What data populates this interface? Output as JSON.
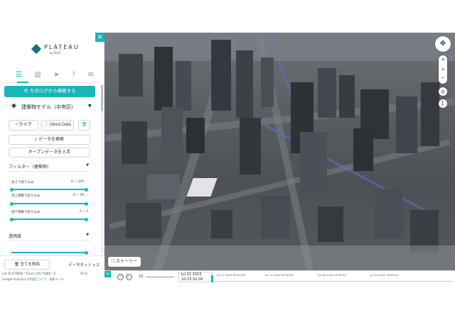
{
  "logo": {
    "name": "PLATEAU",
    "sub": "by MLIT"
  },
  "sidebar": {
    "close_icon": "×",
    "nav_icons": [
      "layers-icon",
      "buildings-icon",
      "share-icon",
      "help-icon",
      "feedback-icon"
    ],
    "catalog_button": "カタログから検索する",
    "layer": {
      "title": "建築物モデル（中央区）"
    },
    "camera_button": "カメラ",
    "about_button": "About Data",
    "search_data_button": "データを検索",
    "opendata_button": "オープンデータを入手",
    "filter": {
      "title": "フィルター（建築物）",
      "rows": [
        {
          "label": "高さで絞り込み",
          "value": "0 ~ 200"
        },
        {
          "label": "地上階数で絞り込み",
          "value": "0 ~ 50"
        },
        {
          "label": "地下階数で絞り込み",
          "value": "0 ~ 5"
        }
      ]
    },
    "transparency_label": "透明度",
    "clear_button": "全てを削除",
    "dataset_label": "データセット x 2",
    "coords": "Lat 35.679688 ° N    Lon 139.75888 ° E",
    "scale": "50 m",
    "footer_links": "Google Analytics の利用について　地形データ"
  },
  "map": {
    "story_button": "ストーリー"
  },
  "timeline": {
    "speed": "X1",
    "date_line1": "Jul 22 2023",
    "date_line2": "10:23:32.00",
    "ticks": [
      "Jul 22 2023 00:00:00",
      "Jul 22 2023 06:00:00",
      "Jul 22 2023 12:00:00",
      "Jul 22 2023 18:00:00"
    ],
    "accent": "#19b5b8"
  }
}
